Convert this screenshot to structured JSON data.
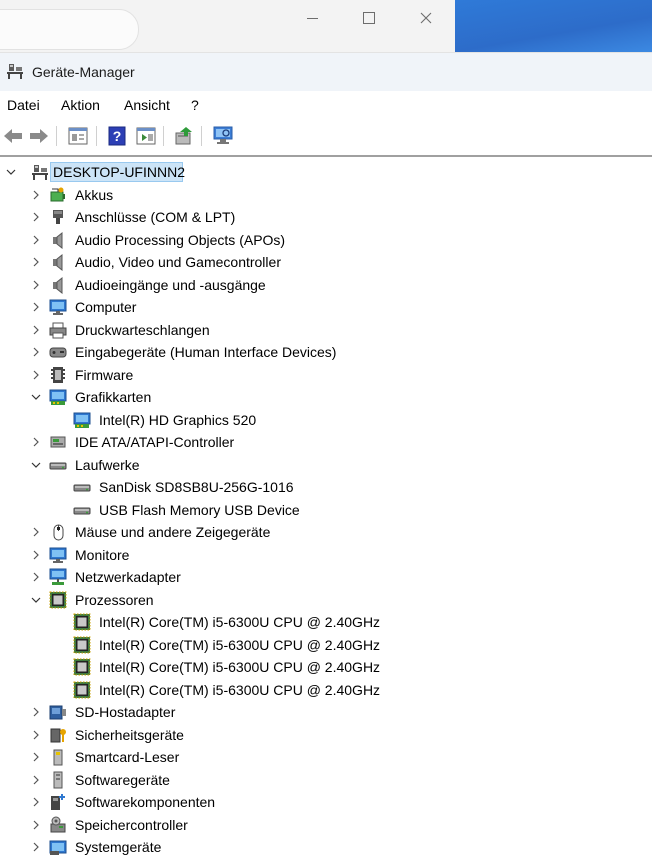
{
  "window": {
    "title": "Geräte-Manager"
  },
  "menu": {
    "items": [
      "Datei",
      "Aktion",
      "Ansicht",
      "?"
    ]
  },
  "toolbar": {
    "buttons": [
      "back-arrow-icon",
      "forward-arrow-icon",
      "properties-icon",
      "help-icon",
      "view-icon",
      "update-driver-icon",
      "scan-hardware-icon"
    ]
  },
  "tree": {
    "root": "DESKTOP-UFINNN2",
    "rows": [
      {
        "label": "Akkus",
        "level": 1,
        "expanded": false,
        "icon": "battery-icon"
      },
      {
        "label": "Anschlüsse (COM & LPT)",
        "level": 1,
        "expanded": false,
        "icon": "port-icon"
      },
      {
        "label": "Audio Processing Objects (APOs)",
        "level": 1,
        "expanded": false,
        "icon": "speaker-icon"
      },
      {
        "label": "Audio, Video und Gamecontroller",
        "level": 1,
        "expanded": false,
        "icon": "speaker-icon"
      },
      {
        "label": "Audioeingänge und -ausgänge",
        "level": 1,
        "expanded": false,
        "icon": "speaker-icon"
      },
      {
        "label": "Computer",
        "level": 1,
        "expanded": false,
        "icon": "monitor-icon"
      },
      {
        "label": "Druckwarteschlangen",
        "level": 1,
        "expanded": false,
        "icon": "printer-icon"
      },
      {
        "label": "Eingabegeräte (Human Interface Devices)",
        "level": 1,
        "expanded": false,
        "icon": "hid-icon"
      },
      {
        "label": "Firmware",
        "level": 1,
        "expanded": false,
        "icon": "firmware-icon"
      },
      {
        "label": "Grafikkarten",
        "level": 1,
        "expanded": true,
        "icon": "display-adapter-icon"
      },
      {
        "label": "Intel(R) HD Graphics 520",
        "level": 2,
        "icon": "display-adapter-icon"
      },
      {
        "label": "IDE ATA/ATAPI-Controller",
        "level": 1,
        "expanded": false,
        "icon": "ide-controller-icon"
      },
      {
        "label": "Laufwerke",
        "level": 1,
        "expanded": true,
        "icon": "drive-icon"
      },
      {
        "label": "SanDisk SD8SB8U-256G-1016",
        "level": 2,
        "icon": "drive-icon"
      },
      {
        "label": "USB Flash Memory USB Device",
        "level": 2,
        "icon": "drive-icon"
      },
      {
        "label": "Mäuse und andere Zeigegeräte",
        "level": 1,
        "expanded": false,
        "icon": "mouse-icon"
      },
      {
        "label": "Monitore",
        "level": 1,
        "expanded": false,
        "icon": "monitor-icon"
      },
      {
        "label": "Netzwerkadapter",
        "level": 1,
        "expanded": false,
        "icon": "network-icon"
      },
      {
        "label": "Prozessoren",
        "level": 1,
        "expanded": true,
        "icon": "cpu-icon"
      },
      {
        "label": "Intel(R) Core(TM) i5-6300U CPU @ 2.40GHz",
        "level": 2,
        "icon": "cpu-icon"
      },
      {
        "label": "Intel(R) Core(TM) i5-6300U CPU @ 2.40GHz",
        "level": 2,
        "icon": "cpu-icon"
      },
      {
        "label": "Intel(R) Core(TM) i5-6300U CPU @ 2.40GHz",
        "level": 2,
        "icon": "cpu-icon"
      },
      {
        "label": "Intel(R) Core(TM) i5-6300U CPU @ 2.40GHz",
        "level": 2,
        "icon": "cpu-icon"
      },
      {
        "label": "SD-Hostadapter",
        "level": 1,
        "expanded": false,
        "icon": "sd-host-icon"
      },
      {
        "label": "Sicherheitsgeräte",
        "level": 1,
        "expanded": false,
        "icon": "security-device-icon"
      },
      {
        "label": "Smartcard-Leser",
        "level": 1,
        "expanded": false,
        "icon": "smartcard-reader-icon"
      },
      {
        "label": "Softwaregeräte",
        "level": 1,
        "expanded": false,
        "icon": "software-device-icon"
      },
      {
        "label": "Softwarekomponenten",
        "level": 1,
        "expanded": false,
        "icon": "software-component-icon"
      },
      {
        "label": "Speichercontroller",
        "level": 1,
        "expanded": false,
        "icon": "storage-controller-icon"
      },
      {
        "label": "Systemgeräte",
        "level": 1,
        "expanded": false,
        "icon": "system-device-icon"
      }
    ]
  }
}
